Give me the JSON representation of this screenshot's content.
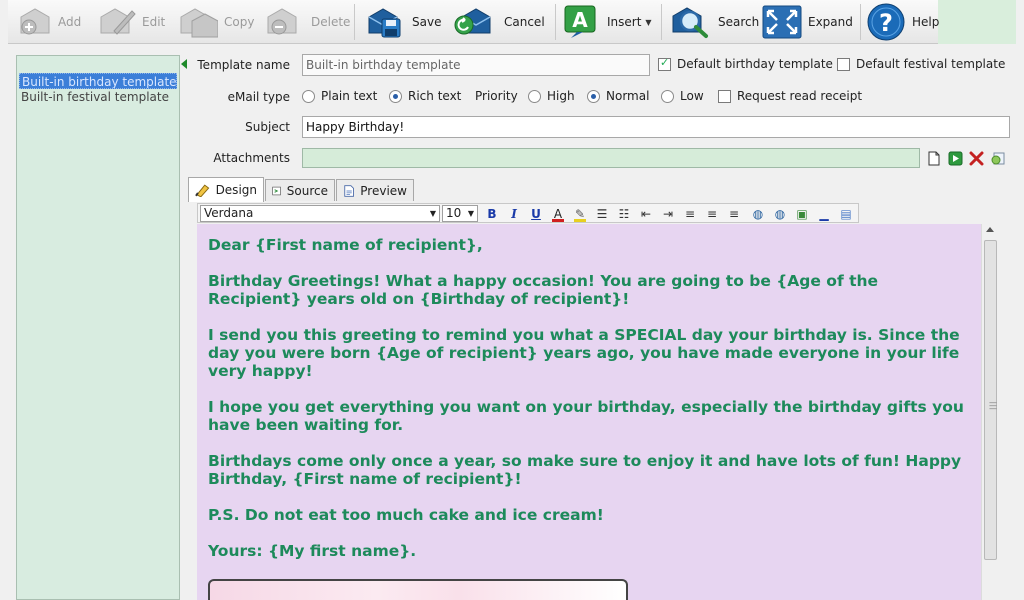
{
  "toolbar": {
    "add": "Add",
    "edit": "Edit",
    "copy": "Copy",
    "delete": "Delete",
    "save": "Save",
    "cancel": "Cancel",
    "insert": "Insert",
    "search": "Search",
    "expand": "Expand",
    "help": "Help"
  },
  "templates": {
    "items": [
      "Built-in birthday template",
      "Built-in festival template"
    ],
    "selected_index": 0
  },
  "form": {
    "template_name_label": "Template name",
    "template_name_value": "Built-in birthday template",
    "default_birthday_label": "Default birthday template",
    "default_birthday_checked": true,
    "default_festival_label": "Default festival template",
    "default_festival_checked": false,
    "email_type_label": "eMail type",
    "plain_text_label": "Plain text",
    "rich_text_label": "Rich text",
    "email_type_selected": "Rich text",
    "priority_label": "Priority",
    "high_label": "High",
    "normal_label": "Normal",
    "low_label": "Low",
    "priority_selected": "Normal",
    "read_receipt_label": "Request read receipt",
    "read_receipt_checked": false,
    "subject_label": "Subject",
    "subject_value": "Happy Birthday!",
    "attachments_label": "Attachments",
    "attachments_value": ""
  },
  "tabs": {
    "design": "Design",
    "source": "Source",
    "preview": "Preview",
    "active": "Design"
  },
  "editor_toolbar": {
    "font_family": "Verdana",
    "font_size": "10"
  },
  "editor": {
    "paragraphs": [
      "Dear {First name of recipient},",
      "Birthday Greetings! What a happy occasion! You are going to be {Age of the Recipient} years old on {Birthday of recipient}!",
      "I send you this greeting to remind you what a SPECIAL day your birthday is. Since the day you were born {Age of recipient} years ago, you have made everyone in your life very happy!",
      "I hope you get everything you want on your birthday, especially the birthday gifts you have been waiting for.",
      "Birthdays come only once a year, so make sure to enjoy it and have lots of fun! Happy Birthday, {First name of recipient}!",
      "P.S. Do not eat too much cake and ice cream!",
      "Yours: {My first name}."
    ],
    "text_color": "#1d8a5b",
    "background_color": "#e7d5f1"
  }
}
